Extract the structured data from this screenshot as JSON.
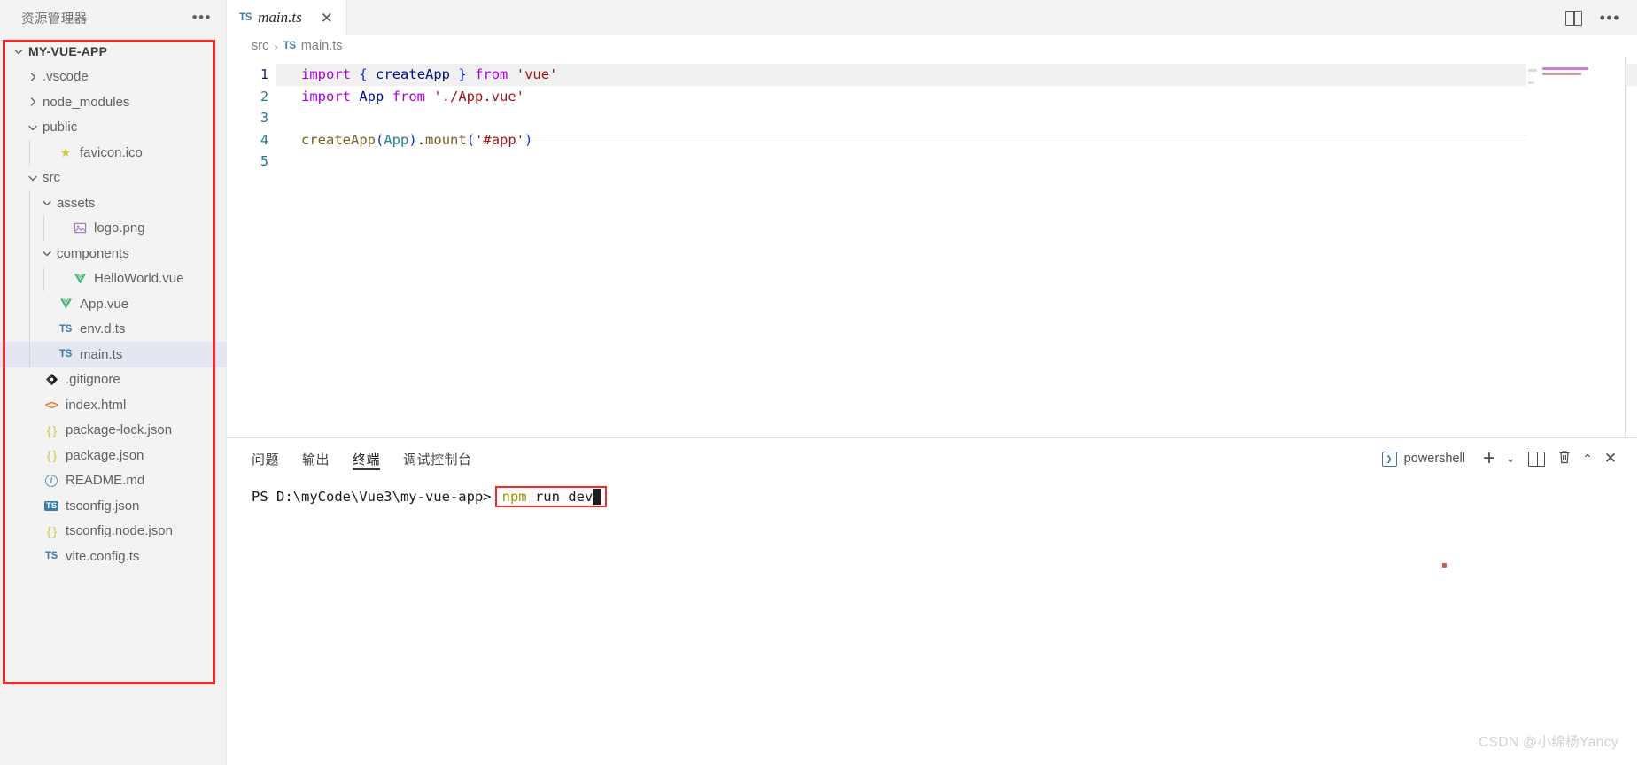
{
  "window": {
    "watermark": "CSDN @小绵杨Yancy"
  },
  "sidebar": {
    "title": "资源管理器",
    "more_label": "•••",
    "root": {
      "label": "MY-VUE-APP",
      "expanded": true
    },
    "items": [
      {
        "label": ".vscode",
        "icon": "chevron-right-icon",
        "kind": "folder",
        "indent": 1,
        "expanded": false
      },
      {
        "label": "node_modules",
        "icon": "chevron-right-icon",
        "kind": "folder",
        "indent": 1,
        "expanded": false
      },
      {
        "label": "public",
        "icon": "chevron-down-icon",
        "kind": "folder",
        "indent": 1,
        "expanded": true
      },
      {
        "label": "favicon.ico",
        "icon": "star-icon",
        "kind": "file",
        "indent": 2,
        "expanded": false
      },
      {
        "label": "src",
        "icon": "chevron-down-icon",
        "kind": "folder",
        "indent": 1,
        "expanded": true
      },
      {
        "label": "assets",
        "icon": "chevron-down-icon",
        "kind": "folder",
        "indent": 2,
        "expanded": true
      },
      {
        "label": "logo.png",
        "icon": "image-icon",
        "kind": "file",
        "indent": 3,
        "expanded": false
      },
      {
        "label": "components",
        "icon": "chevron-down-icon",
        "kind": "folder",
        "indent": 2,
        "expanded": true
      },
      {
        "label": "HelloWorld.vue",
        "icon": "vue-icon",
        "kind": "file",
        "indent": 3,
        "expanded": false
      },
      {
        "label": "App.vue",
        "icon": "vue-icon",
        "kind": "file",
        "indent": 2,
        "expanded": false
      },
      {
        "label": "env.d.ts",
        "icon": "typescript-icon",
        "kind": "file",
        "indent": 2,
        "expanded": false
      },
      {
        "label": "main.ts",
        "icon": "typescript-icon",
        "kind": "file",
        "indent": 2,
        "expanded": false,
        "selected": true
      },
      {
        "label": ".gitignore",
        "icon": "git-icon",
        "kind": "file",
        "indent": 1,
        "expanded": false
      },
      {
        "label": "index.html",
        "icon": "html-icon",
        "kind": "file",
        "indent": 1,
        "expanded": false
      },
      {
        "label": "package-lock.json",
        "icon": "json-icon",
        "kind": "file",
        "indent": 1,
        "expanded": false
      },
      {
        "label": "package.json",
        "icon": "json-icon",
        "kind": "file",
        "indent": 1,
        "expanded": false
      },
      {
        "label": "README.md",
        "icon": "info-icon",
        "kind": "file",
        "indent": 1,
        "expanded": false
      },
      {
        "label": "tsconfig.json",
        "icon": "tsconfig-icon",
        "kind": "file",
        "indent": 1,
        "expanded": false
      },
      {
        "label": "tsconfig.node.json",
        "icon": "json-icon",
        "kind": "file",
        "indent": 1,
        "expanded": false
      },
      {
        "label": "vite.config.ts",
        "icon": "typescript-icon",
        "kind": "file",
        "indent": 1,
        "expanded": false
      }
    ]
  },
  "editor": {
    "tab": {
      "badge": "TS",
      "name": "main.ts",
      "close_label": "✕",
      "dirty": false
    },
    "tabbar_actions": {
      "split_label": "split-editor",
      "more_label": "•••"
    },
    "breadcrumb": {
      "parts": [
        "src",
        "main.ts"
      ],
      "separator": "›",
      "badge": "TS"
    },
    "lines": [
      {
        "num": "1",
        "current": true,
        "tokens": [
          {
            "t": "import",
            "c": "kw"
          },
          {
            "t": " ",
            "c": "plain"
          },
          {
            "t": "{",
            "c": "brc"
          },
          {
            "t": " ",
            "c": "plain"
          },
          {
            "t": "createApp",
            "c": "var"
          },
          {
            "t": " ",
            "c": "plain"
          },
          {
            "t": "}",
            "c": "brc"
          },
          {
            "t": " ",
            "c": "plain"
          },
          {
            "t": "from",
            "c": "kw"
          },
          {
            "t": " ",
            "c": "plain"
          },
          {
            "t": "'vue'",
            "c": "str"
          }
        ]
      },
      {
        "num": "2",
        "current": false,
        "tokens": [
          {
            "t": "import",
            "c": "kw"
          },
          {
            "t": " ",
            "c": "plain"
          },
          {
            "t": "App",
            "c": "var"
          },
          {
            "t": " ",
            "c": "plain"
          },
          {
            "t": "from",
            "c": "kw"
          },
          {
            "t": " ",
            "c": "plain"
          },
          {
            "t": "'./App.vue'",
            "c": "str"
          }
        ]
      },
      {
        "num": "3",
        "current": false,
        "tokens": []
      },
      {
        "num": "4",
        "current": false,
        "tokens": [
          {
            "t": "createApp",
            "c": "fn"
          },
          {
            "t": "(",
            "c": "paren"
          },
          {
            "t": "App",
            "c": "type"
          },
          {
            "t": ")",
            "c": "paren"
          },
          {
            "t": ".",
            "c": "plain"
          },
          {
            "t": "mount",
            "c": "fn"
          },
          {
            "t": "(",
            "c": "paren"
          },
          {
            "t": "'#app'",
            "c": "str"
          },
          {
            "t": ")",
            "c": "paren"
          }
        ]
      },
      {
        "num": "5",
        "current": false,
        "tokens": []
      }
    ]
  },
  "panel": {
    "tabs": [
      {
        "label": "问题",
        "active": false
      },
      {
        "label": "输出",
        "active": false
      },
      {
        "label": "终端",
        "active": true
      },
      {
        "label": "调试控制台",
        "active": false
      }
    ],
    "terminal_name": "powershell",
    "terminal_glyph": "❯",
    "actions": {
      "new_terminal": "+",
      "dropdown": "⌄",
      "split_terminal": "split-terminal",
      "kill_terminal": "🗑",
      "maximize": "⌃",
      "close": "✕"
    },
    "terminal": {
      "prompt": "PS D:\\myCode\\Vue3\\my-vue-app>",
      "command_highlight": "npm",
      "command_rest": " run dev",
      "cursor": true
    }
  },
  "colors": {
    "annotation_red": "#f52b2b",
    "accent_blue": "#3a7ca8",
    "selection": "#e4e6f1",
    "sidebar_bg": "#f3f3f3",
    "editor_bg": "#ffffff"
  }
}
